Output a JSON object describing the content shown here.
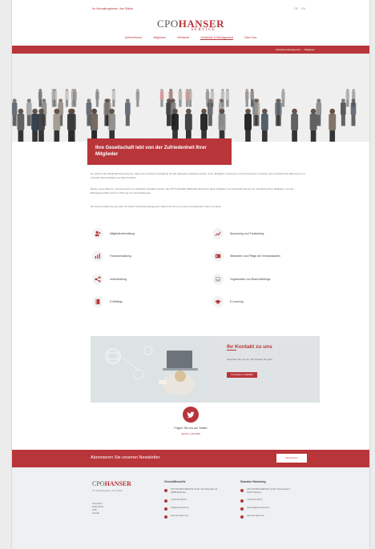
{
  "topbar": {
    "tagline": "Ihr Verwaltungsteam. Ihre Stärke.",
    "langs": [
      "DE",
      "EN"
    ]
  },
  "logo": {
    "main_left": "CPO",
    "main_right": "HANSER",
    "sub": "SERVICE"
  },
  "nav": [
    "Unternehmen",
    "Mitglieder",
    "Verbände",
    "Verbände & Management",
    "Über Uns"
  ],
  "breadcrumb": [
    "Verbände Management",
    "Mitglieder"
  ],
  "hero_title": "Ihre Gesellschaft lebt von der Zufriedenheit Ihrer Mitglieder",
  "intro": [
    "Es zeichnet die Mitgliederbetreuung aus, dass eine komplexe Verwaltung für alle Kategorien geleistet werden muss. Mitglieder, Sponsoren und Interessenten erwarten eine professionelle Betreuung und schnelle Kommunikation auf allen Kanälen.",
    "Beides muss effizient, vertrauensvoll und verlässlich gestaltet werden. Die CPO HANSER SERVICE übernimmt diese Aufgaben und unterstützt Sie bei der Verwaltung Ihrer Mitglieder. Von der Beitragsverwaltung bis zur Planung von Veranstaltungen.",
    "Mit unserer Erfahrung aus über 40 Jahren Verbandsmanagement stehen wir Ihnen mit einem kompetenten Team zur Seite."
  ],
  "features": [
    {
      "label": "Mitgliederverwaltung",
      "icon": "members-icon"
    },
    {
      "label": "Sponsoring und Fundraising",
      "icon": "chart-up-icon"
    },
    {
      "label": "Finanzverwaltung",
      "icon": "bar-chart-icon"
    },
    {
      "label": "Webseiten und Pflege der Verbandsdaten",
      "icon": "id-card-icon"
    },
    {
      "label": "Unterstützung",
      "icon": "share-icon"
    },
    {
      "label": "Organisation von Board Meetings",
      "icon": "laptop-icon"
    },
    {
      "label": "E-Mailings",
      "icon": "book-icon"
    },
    {
      "label": "E-Learning",
      "icon": "graduation-cap-icon"
    }
  ],
  "contact": {
    "title": "Ihr Kontakt zu uns",
    "text": "Sprechen Sie uns an. Wir beraten Sie gern.",
    "button": "Ihr Kontakt zu HANSER"
  },
  "twitter": {
    "title": "Folgen Sie uns auf Twitter",
    "handle": "@CPO_HANSER"
  },
  "newsletter": {
    "label": "Abonnieren Sie unseren Newsletter",
    "button": "Abonnieren"
  },
  "footer": {
    "logo_left": "CPO",
    "logo_right": "HANSER",
    "logo_sub": "Ihr Verwaltungsteam. Ihre Stärke.",
    "links": [
      "Impressum",
      "Datenschutz",
      "AGB",
      "Kontakt"
    ],
    "col1": {
      "title": "Geschäftsstelle",
      "address": "CPO HANSER SERVICE GmbH, Zum Ehrenhain 34, 22885 Barsbüttel",
      "phone": "+49 40 670 88 20",
      "mail": "info@cpo-hanser.de",
      "web": "www.cpo-hanser.de"
    },
    "col2": {
      "title": "Standort Hamburg",
      "address": "CPO HANSER SERVICE GmbH, Paulsenplatz 6, 22767 Hamburg",
      "phone": "+49 40 670 88 21",
      "mail": "hamburg@cpo-hanser.de",
      "web": "www.cpo-hanser.de"
    }
  },
  "colors": {
    "brand": "#b8353a",
    "footer_bg": "#eef0f1"
  }
}
